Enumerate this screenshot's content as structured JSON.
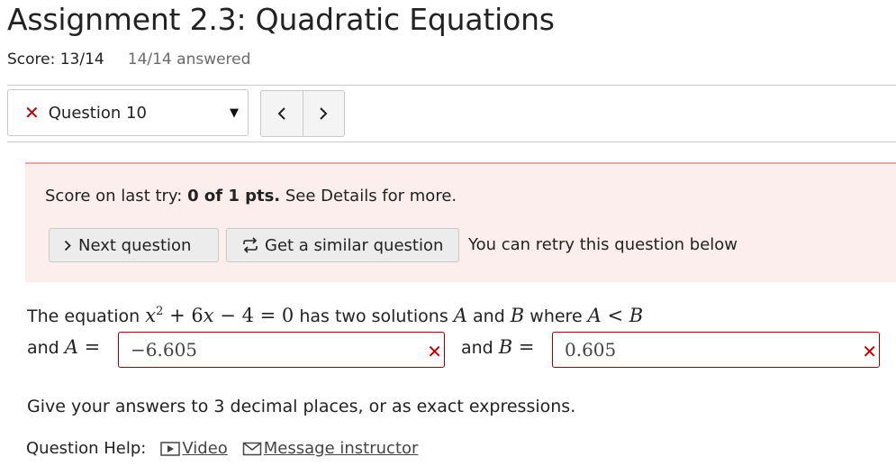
{
  "header": {
    "title": "Assignment 2.3: Quadratic Equations",
    "score": "Score: 13/14",
    "answered": "14/14 answered"
  },
  "question_nav": {
    "status_icon": "x-mark-icon",
    "selected_question": "Question 10",
    "prev_icon": "chevron-left-icon",
    "next_icon": "chevron-right-icon"
  },
  "feedback": {
    "score_prefix": "Score on last try: ",
    "score_value": "0 of 1 pts.",
    "score_suffix": " See Details for more.",
    "next_button": "Next question",
    "similar_button": "Get a similar question",
    "retry_text": "You can retry this question below"
  },
  "question": {
    "intro": "The equation ",
    "mid": " has two solutions ",
    "and_word": " and ",
    "where_word": " where ",
    "row2_and": "and",
    "row2_and_b": "and",
    "answer_a": "−6.605",
    "answer_b": "0.605",
    "instruction": "Give your answers to 3 decimal places, or as exact expressions."
  },
  "help": {
    "label": "Question Help:",
    "video": "Video",
    "message": "Message instructor"
  },
  "colors": {
    "error_red": "#c00000",
    "feedback_bg": "#fdeeee",
    "feedback_border": "#f3a3a3"
  }
}
